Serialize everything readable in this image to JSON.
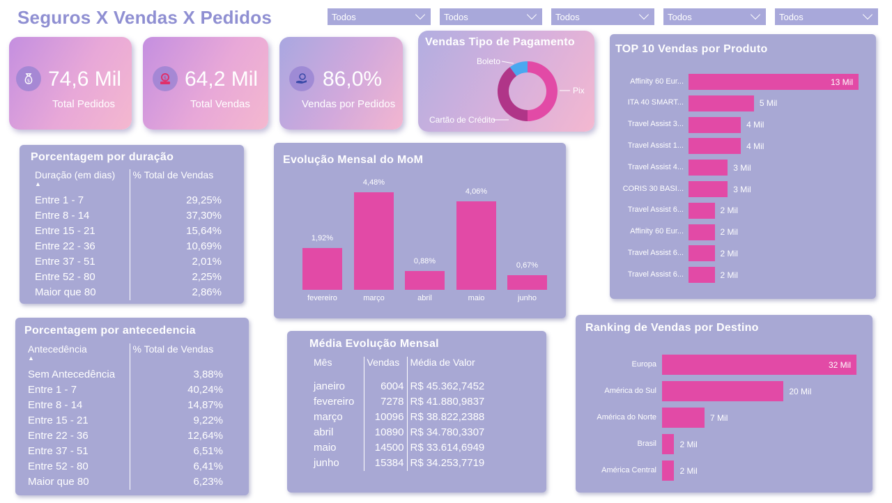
{
  "header": {
    "title": "Seguros X Vendas X Pedidos"
  },
  "slicers": [
    "Todos",
    "Todos",
    "Todos",
    "Todos",
    "Todos"
  ],
  "kpis": [
    {
      "value": "74,6 Mil",
      "label": "Total Pedidos",
      "icon": "money-bag-icon"
    },
    {
      "value": "64,2 Mil",
      "label": "Total Vendas",
      "icon": "cash-register-icon"
    },
    {
      "value": "86,0%",
      "label": "Vendas por Pedidos",
      "icon": "hand-coin-icon"
    }
  ],
  "payment": {
    "title": "Vendas Tipo de Pagamento",
    "chart_data": {
      "type": "pie",
      "slices": [
        {
          "label": "Pix",
          "value": 50,
          "color": "#e24aa6"
        },
        {
          "label": "Cartão de Crédito",
          "value": 40,
          "color": "#b03588"
        },
        {
          "label": "Boleto",
          "value": 10,
          "color": "#4aa8f0"
        }
      ]
    }
  },
  "top10": {
    "title": "TOP 10 Vendas por Produto",
    "chart_data": {
      "type": "bar",
      "orientation": "horizontal",
      "categories": [
        "Affinity 60 Eur...",
        "ITA 40 SMART...",
        "Travel Assist 3...",
        "Travel Assist 1...",
        "Travel Assist 4...",
        "CORIS 30 BASI...",
        "Travel Assist 6...",
        "Affinity 60 Eur...",
        "Travel Assist 6...",
        "Travel Assist 6..."
      ],
      "values": [
        13,
        5,
        4,
        4,
        3,
        3,
        2,
        2,
        2,
        2
      ],
      "labels": [
        "13 Mil",
        "5 Mil",
        "4 Mil",
        "4 Mil",
        "3 Mil",
        "3 Mil",
        "2 Mil",
        "2 Mil",
        "2 Mil",
        "2 Mil"
      ],
      "color": "#e24aa6"
    }
  },
  "duracao": {
    "title": "Porcentagem por duração",
    "col1": "Duração (em dias)",
    "col2": "% Total de Vendas",
    "rows": [
      [
        "Entre 1 - 7",
        "29,25%"
      ],
      [
        "Entre 8 - 14",
        "37,30%"
      ],
      [
        "Entre 15 - 21",
        "15,64%"
      ],
      [
        "Entre 22 - 36",
        "10,69%"
      ],
      [
        "Entre 37 - 51",
        "2,01%"
      ],
      [
        "Entre 52 - 80",
        "2,25%"
      ],
      [
        "Maior que 80",
        "2,86%"
      ]
    ]
  },
  "mom": {
    "title": "Evolução Mensal do MoM",
    "chart_data": {
      "type": "bar",
      "categories": [
        "fevereiro",
        "março",
        "abril",
        "maio",
        "junho"
      ],
      "values": [
        1.92,
        4.48,
        0.88,
        4.06,
        0.67
      ],
      "labels": [
        "1,92%",
        "4,48%",
        "0,88%",
        "4,06%",
        "0,67%"
      ],
      "color": "#e24aa6"
    }
  },
  "antecedencia": {
    "title": "Porcentagem por antecedencia",
    "col1": "Antecedência",
    "col2": "% Total de Vendas",
    "rows": [
      [
        "Sem Antecedência",
        "3,88%"
      ],
      [
        "Entre 1 - 7",
        "40,24%"
      ],
      [
        "Entre 8 - 14",
        "14,87%"
      ],
      [
        "Entre 15 - 21",
        "9,22%"
      ],
      [
        "Entre 22 - 36",
        "12,64%"
      ],
      [
        "Entre 37 - 51",
        "6,51%"
      ],
      [
        "Entre 52 - 80",
        "6,41%"
      ],
      [
        "Maior que 80",
        "6,23%"
      ]
    ]
  },
  "media": {
    "title": "Média Evolução Mensal",
    "col1": "Mês",
    "col2": "Vendas",
    "col3": "Média de Valor",
    "rows": [
      [
        "janeiro",
        "6004",
        "R$ 45.362,7452"
      ],
      [
        "fevereiro",
        "7278",
        "R$ 41.880,9837"
      ],
      [
        "março",
        "10096",
        "R$ 38.822,2388"
      ],
      [
        "abril",
        "10890",
        "R$ 34.780,3307"
      ],
      [
        "maio",
        "14500",
        "R$ 33.614,6949"
      ],
      [
        "junho",
        "15384",
        "R$ 34.253,7719"
      ]
    ]
  },
  "destino": {
    "title": "Ranking de Vendas por Destino",
    "chart_data": {
      "type": "bar",
      "orientation": "horizontal",
      "categories": [
        "Europa",
        "América do Sul",
        "América do Norte",
        "Brasil",
        "América Central"
      ],
      "values": [
        32,
        20,
        7,
        2,
        2
      ],
      "labels": [
        "32 Mil",
        "20 Mil",
        "7 Mil",
        "2 Mil",
        "2 Mil"
      ],
      "color": "#e24aa6"
    }
  }
}
